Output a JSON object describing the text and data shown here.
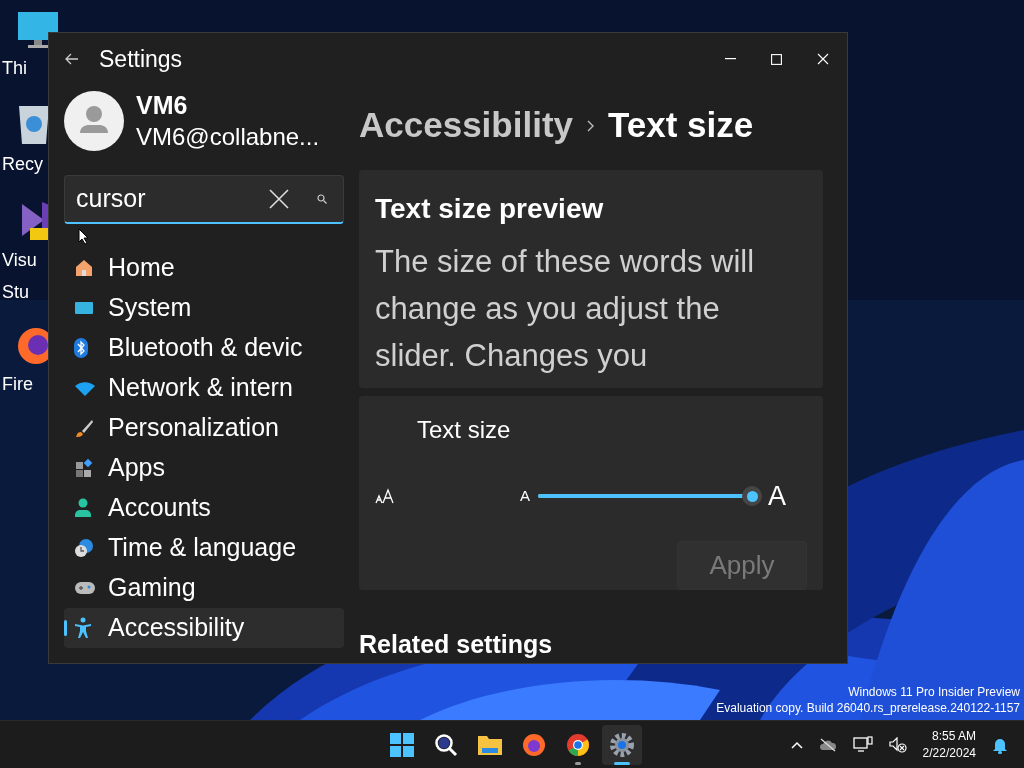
{
  "desktop": {
    "icons": [
      {
        "kind": "monitor",
        "lines": [
          "Thi"
        ]
      },
      {
        "kind": "recycle",
        "lines": [
          "Recy"
        ]
      },
      {
        "kind": "studio",
        "lines": [
          "Visu",
          "Stu"
        ]
      },
      {
        "kind": "firefox",
        "lines": [
          "Fire"
        ]
      }
    ],
    "notice": [
      "Windows 11 Pro Insider Preview",
      "Evaluation copy. Build 26040.rs_prerelease.240122-1157"
    ]
  },
  "window": {
    "title": "Settings",
    "user": {
      "name": "VM6",
      "email": "VM6@collabne..."
    },
    "search": {
      "value": "cursor"
    },
    "nav": [
      {
        "kind": "home",
        "label": "Home",
        "selected": false
      },
      {
        "kind": "system",
        "label": "System",
        "selected": false
      },
      {
        "kind": "bluetooth",
        "label": "Bluetooth & devic",
        "selected": false
      },
      {
        "kind": "wifi",
        "label": "Network & intern",
        "selected": false
      },
      {
        "kind": "brush",
        "label": "Personalization",
        "selected": false
      },
      {
        "kind": "apps",
        "label": "Apps",
        "selected": false
      },
      {
        "kind": "person",
        "label": "Accounts",
        "selected": false
      },
      {
        "kind": "globe",
        "label": "Time & language",
        "selected": false
      },
      {
        "kind": "gamepad",
        "label": "Gaming",
        "selected": false
      },
      {
        "kind": "access",
        "label": "Accessibility",
        "selected": true
      }
    ],
    "breadcrumb": [
      "Accessibility",
      "Text size"
    ],
    "preview": {
      "title": "Text size preview",
      "text": "The size of these words will change as you adjust the slider. Changes you"
    },
    "text_size": {
      "label": "Text size",
      "small": "A",
      "large": "A",
      "level": 1,
      "apply": {
        "label": "Apply",
        "disabled": true
      }
    },
    "related": "Related settings"
  },
  "taskbar": {
    "apps": [
      {
        "kind": "start",
        "running": false,
        "selected": false
      },
      {
        "kind": "search",
        "running": false,
        "selected": false
      },
      {
        "kind": "folder",
        "running": false,
        "selected": false
      },
      {
        "kind": "firefox",
        "running": false,
        "selected": false
      },
      {
        "kind": "chrome",
        "running": true,
        "selected": false
      },
      {
        "kind": "settings",
        "running": true,
        "selected": true
      }
    ],
    "clock": {
      "time": "8:55 AM",
      "date": "2/22/2024"
    }
  }
}
